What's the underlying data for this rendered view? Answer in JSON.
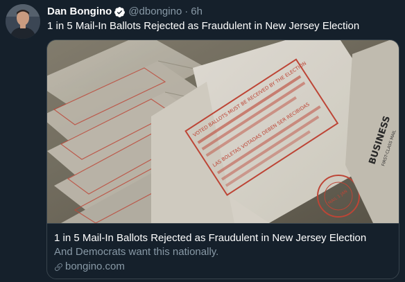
{
  "tweet": {
    "author_name": "Dan Bongino",
    "handle": "@dbongino",
    "separator": "·",
    "time": "6h",
    "text": "1 in 5 Mail-In Ballots Rejected as Fraudulent in New Jersey Election",
    "avatar_icon": "user-avatar",
    "verified_icon": "verified-badge-icon"
  },
  "card": {
    "title": "1 in 5 Mail-In Ballots Rejected as Fraudulent in New Jersey Election",
    "description": "And Democrats want this nationally.",
    "domain": "bongino.com",
    "domain_icon": "link-icon",
    "image": {
      "envelope_texts": {
        "voted_ballots": "VOTED BALLOTS MUST BE RECEIVED BY THE ELECTION",
        "spanish": "LAS BOLETAS VOTADAS DEBEN SER RECIBIDAS",
        "business": "BUSINESS",
        "first_class": "FIRST-CLASS MAIL",
        "postmark": "MAIL 1 JAN"
      }
    }
  },
  "colors": {
    "background": "#15202b",
    "text_primary": "#ffffff",
    "text_secondary": "#8899a6",
    "border": "#38444d",
    "verified_blue": "#1da1f2",
    "envelope_red": "#c94a3a"
  }
}
